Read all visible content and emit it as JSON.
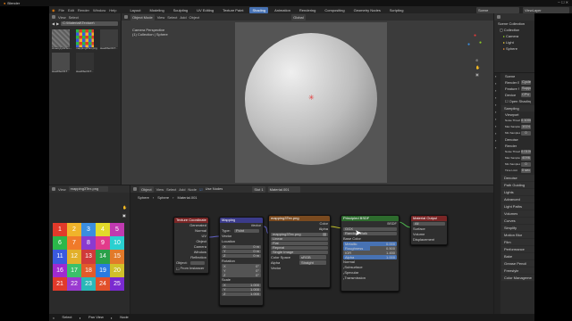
{
  "titlebar": {
    "title": "Blender"
  },
  "menus": [
    "File",
    "Edit",
    "Render",
    "Window",
    "Help"
  ],
  "workspaces": [
    "Layout",
    "Modeling",
    "Sculpting",
    "UV Editing",
    "Texture Paint",
    "Shading",
    "Animation",
    "Rendering",
    "Compositing",
    "Geometry Nodes",
    "Scripting"
  ],
  "active_workspace": "Shading",
  "scene_field": "Scene",
  "viewlayer_field": "ViewLayer",
  "file_browser": {
    "header": [
      "View",
      "Select"
    ],
    "path": "C:\\Materiali\\Texture\\",
    "thumbs": [
      {
        "name": "cimetryly01Tex...",
        "color": "#6a6a6a"
      },
      {
        "name": "mapping3Tex.png",
        "color": "#c85a2a"
      },
      {
        "name": "steelfiber01T...",
        "color": "#555"
      },
      {
        "name": "steelfiber01T...",
        "color": "#4a4a4a"
      },
      {
        "name": "steelfiber01T...",
        "color": "#3e3e3e"
      }
    ]
  },
  "viewport": {
    "mode": "Object Mode",
    "menus": [
      "View",
      "Select",
      "Add",
      "Object"
    ],
    "transform": "Global",
    "info_line1": "Camera Perspective",
    "info_line2": "(1) Collection | Sphere"
  },
  "outliner": {
    "title": "Scene Collection",
    "items": [
      {
        "label": "Collection",
        "color": "#e0e0e0"
      },
      {
        "label": "Camera",
        "color": "#b0b0b0"
      },
      {
        "label": "Light",
        "color": "#b0b0b0"
      },
      {
        "label": "Sphere",
        "color": "#b0b0b0"
      }
    ]
  },
  "properties": {
    "scene_label": "Scene",
    "render_engine_label": "Render Engine",
    "render_engine": "Cycles",
    "feature_set_label": "Feature Set",
    "feature_set": "Supported",
    "device_label": "Device",
    "device": "CPU",
    "osl_label": "Open Shading Language",
    "sampling": "Sampling",
    "viewport": "Viewport",
    "noise_threshold_label": "Noise Threshold",
    "noise_threshold": "0.1000",
    "max_samples_label": "Max Samples",
    "max_samples": "1024",
    "min_samples_label": "Min Samples",
    "min_samples": "0",
    "denoise": "Denoise",
    "render": "Render",
    "r_noise_threshold": "0.0100",
    "r_max_samples": "4096",
    "r_min_samples": "0",
    "time_limit_label": "Time Limit",
    "time_limit": "0 sec",
    "sections": [
      "Denoise",
      "Path Guiding",
      "Lights",
      "Advanced",
      "Light Paths",
      "Volumes",
      "Curves",
      "Simplify",
      "Motion Blur",
      "Film",
      "Performance",
      "Bake",
      "Grease Pencil",
      "Freestyle",
      "Color Management"
    ]
  },
  "image_editor": {
    "menus": [
      "View"
    ],
    "image_name": "mapping3Tex.png",
    "tiles": [
      "1",
      "2",
      "3",
      "4",
      "5",
      "6",
      "7",
      "8",
      "9",
      "10",
      "11",
      "12",
      "13",
      "14",
      "15",
      "16",
      "17",
      "18",
      "19",
      "20",
      "21",
      "22",
      "23",
      "24",
      "25"
    ],
    "tile_colors": [
      "#e23a2a",
      "#f0b32a",
      "#3a8ee0",
      "#e2d92a",
      "#c03ab0",
      "#2ab84a",
      "#f07a2a",
      "#8a3ad0",
      "#e23a8a",
      "#2ad0d0",
      "#3a5ae0",
      "#e2b02a",
      "#d03a3a",
      "#2aa04a",
      "#e27a2a",
      "#a02ad0",
      "#3ac06a",
      "#e25a2a",
      "#2a7ae0",
      "#d0c02a",
      "#e23a2a",
      "#9a3ad0",
      "#2ab8b8",
      "#e2502a",
      "#7a2ad0"
    ]
  },
  "node_editor": {
    "object_mode": "Object",
    "menus": [
      "View",
      "Select",
      "Add",
      "Node"
    ],
    "use_nodes": "Use Nodes",
    "slot": "Slot 1",
    "material": "Material.001",
    "breadcrumb": [
      "Sphere",
      "Sphere",
      "Material.001"
    ],
    "nodes": {
      "texcoord": {
        "title": "Texture Coordinate",
        "outputs": [
          "Generated",
          "Normal",
          "UV",
          "Object",
          "Camera",
          "Window",
          "Reflection"
        ],
        "object_label": "Object:",
        "instancer": "From Instancer"
      },
      "mapping": {
        "title": "Mapping",
        "vector": "Vector",
        "type_label": "Type:",
        "type": "Point",
        "vector_in": "Vector",
        "location": "Location",
        "loc": [
          "0 m",
          "0 m",
          "0 m"
        ],
        "rotation": "Rotation",
        "rot": [
          "0°",
          "0°",
          "0°"
        ],
        "scale": "Scale",
        "scl": [
          "1.000",
          "1.000",
          "1.000"
        ]
      },
      "image": {
        "title": "mapping3Tex.png",
        "color": "Color",
        "alpha": "Alpha",
        "file": "mapping3Tex.png",
        "interp": "Linear",
        "proj": "Flat",
        "ext": "Repeat",
        "source": "Single Image",
        "colorspace_label": "Color Space",
        "colorspace": "sRGB",
        "alpha_label": "Alpha",
        "alpha_mode": "Straight",
        "vector": "Vector"
      },
      "bsdf": {
        "title": "Principled BSDF",
        "bsdf_out": "BSDF",
        "dist": "GGX",
        "sss": "Random Walk",
        "base_color": "Base Color",
        "metallic": "Metallic",
        "metallic_v": "0.000",
        "roughness": "Roughness",
        "roughness_v": "0.500",
        "ior": "IOR",
        "ior_v": "1.450",
        "alpha": "Alpha",
        "alpha_v": "1.000",
        "normal": "Normal",
        "subs": [
          "Subsurface",
          "Specular",
          "Transmission",
          "Coat",
          "Sheen",
          "Emission"
        ]
      },
      "output": {
        "title": "Material Output",
        "target": "All",
        "inputs": [
          "Surface",
          "Volume",
          "Displacement"
        ]
      }
    }
  },
  "statusbar": [
    "Select",
    "Pan View",
    "Node"
  ],
  "colors": {
    "accent": "#4772b3",
    "bsdf_header": "#2d6b2d",
    "output_header": "#7a2626",
    "tex_header": "#7a4a1f",
    "vector_header": "#3b3b8a",
    "input_header": "#7a2626"
  }
}
